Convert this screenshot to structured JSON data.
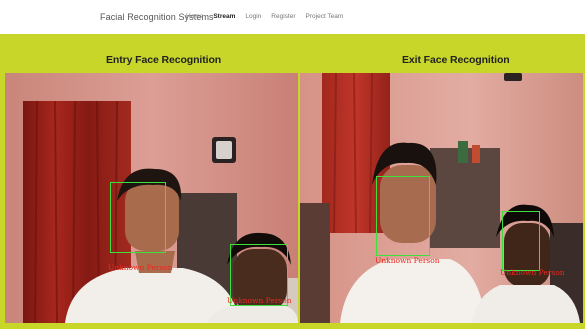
{
  "nav": {
    "brand": "Facial Recognition Systems",
    "links": [
      "Home",
      "Stream",
      "Login",
      "Register",
      "Project Team"
    ],
    "active": "Stream"
  },
  "entry": {
    "title": "Entry Face Recognition",
    "labels": [
      "Unknown Person",
      "Unknown Person"
    ]
  },
  "exit": {
    "title": "Exit Face Recognition",
    "labels": [
      "Unknown Person",
      "Unknown Person"
    ]
  },
  "colors": {
    "accent": "#c8d62a",
    "box": "#3de03d",
    "label": "#e8281e"
  }
}
